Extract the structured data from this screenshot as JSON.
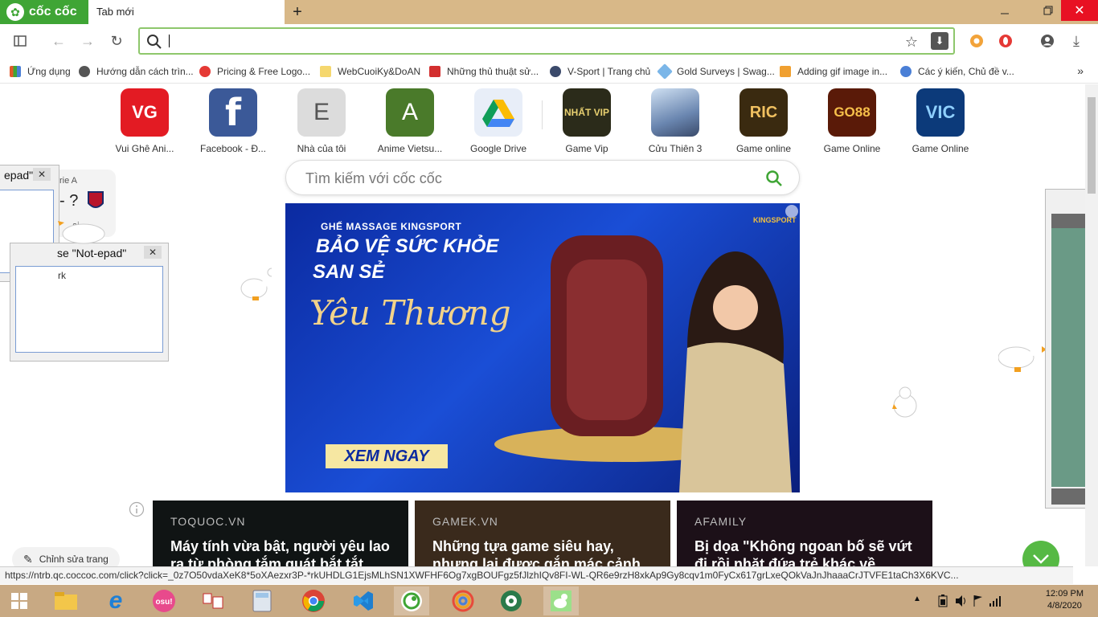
{
  "browser": {
    "brand": "cốc cốc",
    "active_tab": "Tab mới",
    "new_tab": "+"
  },
  "toolbar": {
    "omnibox_value": ""
  },
  "bookmarks": [
    {
      "label": "Ứng dụng",
      "color": "#e05a2a"
    },
    {
      "label": "Hướng dẫn cách trìn...",
      "color": "#555555"
    },
    {
      "label": "Pricing & Free Logo...",
      "color": "#e53935"
    },
    {
      "label": "WebCuoiKy&DoAN",
      "color": "#f5d76e"
    },
    {
      "label": "Những thủ thuật sử...",
      "color": "#d32f2f"
    },
    {
      "label": "V-Sport | Trang chủ",
      "color": "#3b4a6b"
    },
    {
      "label": "Gold Surveys | Swag...",
      "color": "#7bb6e8"
    },
    {
      "label": "Adding gif image in...",
      "color": "#f0a030"
    },
    {
      "label": "Các ý kiến, Chủ đề v...",
      "color": "#4a7fd6"
    }
  ],
  "speed_dial": [
    {
      "label": "Vui Ghê Ani...",
      "tile_text": "VG",
      "bg": "#e31b23"
    },
    {
      "label": "Facebook - Đ...",
      "tile_text": "f",
      "bg": "#3b5998"
    },
    {
      "label": "Nhà của tôi",
      "tile_text": "E",
      "bg": "#dcdcdc"
    },
    {
      "label": "Anime Vietsu...",
      "tile_text": "A",
      "bg": "#4a7a2a"
    },
    {
      "label": "Google Drive",
      "tile_text": "",
      "bg": "#e8eef8"
    },
    {
      "label": "Game Vip",
      "tile_text": "NHẤT VIP",
      "bg": "#2b2b1a"
    },
    {
      "label": "Cửu Thiên 3",
      "tile_text": "",
      "bg": "#8aa6c8"
    },
    {
      "label": "Game online",
      "tile_text": "RIC",
      "bg": "#3a2a10"
    },
    {
      "label": "Game Online",
      "tile_text": "GO88",
      "bg": "#5a1a08"
    },
    {
      "label": "Game Online",
      "tile_text": "VIC",
      "bg": "#0c3a7a"
    }
  ],
  "search": {
    "placeholder": "Tìm kiếm với cốc cốc"
  },
  "banner": {
    "brand": "GHẾ MASSAGE KINGSPORT",
    "headline1": "BẢO VỆ SỨC KHỎE",
    "headline2": "SAN SẺ",
    "script": "Yêu Thương",
    "cta": "XEM NGAY",
    "logo": "KINGSPORT"
  },
  "news": [
    {
      "source": "TOQUOC.VN",
      "title": "Máy tính vừa bật, người yêu lao ra từ phòng tắm quát bắt tắt",
      "bg": "#101414"
    },
    {
      "source": "GAMEK.VN",
      "title": "Những tựa game siêu hay, nhưng lại được gắn mác cảnh",
      "bg": "#3a2a1c"
    },
    {
      "source": "AFAMILY",
      "title": "Bị dọa \"Không ngoan bố sẽ vứt đi rồi nhặt đứa trẻ khác về",
      "bg": "#1c1018"
    }
  ],
  "edit_button": "Chỉnh sửa trang",
  "popups": {
    "p1_title": "epad\"",
    "p2_title": "se \"Not-epad\"",
    "p2_body": "rk",
    "score_league": "rie A",
    "score_value": "- ?",
    "score_sub": "ai"
  },
  "status_url": "https://ntrb.qc.coccoc.com/click?click=_0z7O50vdaXeK8*5oXAezxr3P-*rkUHDLG1EjsMLhSN1XWFHF6Og7xgBOUFgz5fJlzhIQv8FI-WL-QR6e9rzH8xkAp9Gy8cqv1m0FyCx617grLxeQOkVaJnJhaaaCrJTVFE1taCh3X6KVC...",
  "clock": {
    "time": "12:09 PM",
    "date": "4/8/2020"
  }
}
